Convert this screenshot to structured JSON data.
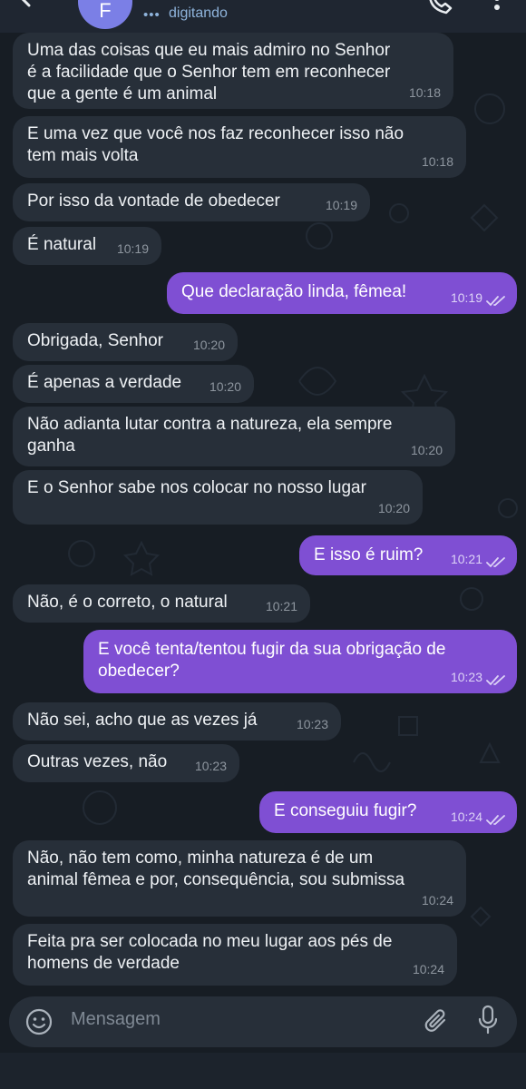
{
  "header": {
    "avatar_letter": "F",
    "status": "digitando",
    "status_dots": "•••"
  },
  "messages": [
    {
      "dir": "in",
      "text": "Uma das coisas que eu mais admiro no Senhor\né a facilidade que o Senhor tem em reconhecer\nque a gente é um animal",
      "time": "10:18"
    },
    {
      "dir": "in",
      "text": "E uma vez que você nos faz reconhecer isso não\ntem mais volta",
      "time": "10:18"
    },
    {
      "dir": "in",
      "text": "Por isso da vontade de obedecer",
      "time": "10:19"
    },
    {
      "dir": "in",
      "text": "É natural",
      "time": "10:19"
    },
    {
      "dir": "out",
      "text": "Que declaração linda, fêmea!",
      "time": "10:19"
    },
    {
      "dir": "in",
      "text": "Obrigada, Senhor",
      "time": "10:20"
    },
    {
      "dir": "in",
      "text": "É apenas a verdade",
      "time": "10:20"
    },
    {
      "dir": "in",
      "text": "Não adianta lutar contra a natureza, ela sempre\nganha",
      "time": "10:20"
    },
    {
      "dir": "in",
      "text": "E o Senhor sabe nos colocar no nosso lugar",
      "time": "10:20"
    },
    {
      "dir": "out",
      "text": "E isso é ruim?",
      "time": "10:21"
    },
    {
      "dir": "in",
      "text": "Não, é o correto, o natural",
      "time": "10:21"
    },
    {
      "dir": "out",
      "text": "E você tenta/tentou fugir da sua obrigação de\nobedecer?",
      "time": "10:23"
    },
    {
      "dir": "in",
      "text": "Não sei, acho que as vezes já",
      "time": "10:23"
    },
    {
      "dir": "in",
      "text": "Outras vezes, não",
      "time": "10:23"
    },
    {
      "dir": "out",
      "text": "E conseguiu fugir?",
      "time": "10:24"
    },
    {
      "dir": "in",
      "text": "Não, não tem como, minha natureza é de um\nanimal fêmea e por, consequência, sou submissa",
      "time": "10:24"
    },
    {
      "dir": "in",
      "text": "Feita pra ser colocada no meu lugar aos pés de\nhomens de verdade",
      "time": "10:24"
    }
  ],
  "composer": {
    "placeholder": "Mensagem"
  },
  "colors": {
    "background": "#171d24",
    "incoming_bubble": "#272f39",
    "outgoing_bubble": "#7f4fd3",
    "accent": "#8fb4dc"
  }
}
